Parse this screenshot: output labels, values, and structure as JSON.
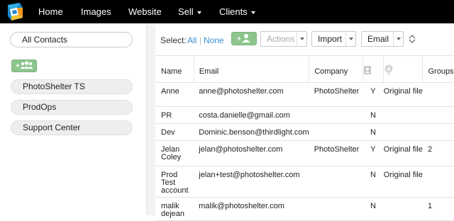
{
  "app": {
    "logo": "photoshelter-logo"
  },
  "nav": {
    "items": [
      {
        "label": "Home",
        "dropdown": false
      },
      {
        "label": "Images",
        "dropdown": false
      },
      {
        "label": "Website",
        "dropdown": false
      },
      {
        "label": "Sell",
        "dropdown": true
      },
      {
        "label": "Clients",
        "dropdown": true
      }
    ]
  },
  "sidebar": {
    "all_contacts": "All Contacts",
    "add_group_icon": "add-group-icon",
    "groups": [
      {
        "label": "PhotoShelter TS"
      },
      {
        "label": "ProdOps"
      },
      {
        "label": "Support Center"
      }
    ]
  },
  "toolbar": {
    "select_label": "Select:",
    "select_all": "All",
    "select_sep": "|",
    "select_none": "None",
    "add_contact_icon": "add-contact-icon",
    "actions": "Actions",
    "import": "Import",
    "email": "Email",
    "sort_icon": "sort-icon"
  },
  "table": {
    "headers": {
      "name": "Name",
      "email": "Email",
      "company": "Company",
      "col4_icon": "contact-card-icon",
      "col5_icon": "download-icon",
      "groups": "Groups"
    },
    "rows": [
      {
        "name": "Anne",
        "email": "anne@photoshelter.com",
        "company": "PhotoShelter",
        "flag": "Y",
        "file": "Original file",
        "groups": ""
      },
      {
        "name": "PR",
        "email": "costa.danielle@gmail.com",
        "company": "",
        "flag": "N",
        "file": "",
        "groups": ""
      },
      {
        "name": "Dev",
        "email": "Dominic.benson@thirdlight.com",
        "company": "",
        "flag": "N",
        "file": "",
        "groups": ""
      },
      {
        "name": "Jelan Coley",
        "email": "jelan@photoshelter.com",
        "company": "PhotoShelter",
        "flag": "Y",
        "file": "Original file",
        "groups": "2"
      },
      {
        "name": "Prod Test account",
        "email": "jelan+test@photoshelter.com",
        "company": "",
        "flag": "N",
        "file": "Original file",
        "groups": ""
      },
      {
        "name": "malik dejean",
        "email": "malik@photoshelter.com",
        "company": "",
        "flag": "N",
        "file": "",
        "groups": "1"
      }
    ]
  },
  "colors": {
    "topbar": "#000000",
    "link": "#3b8fd0",
    "add_button": "#8dc58d"
  }
}
